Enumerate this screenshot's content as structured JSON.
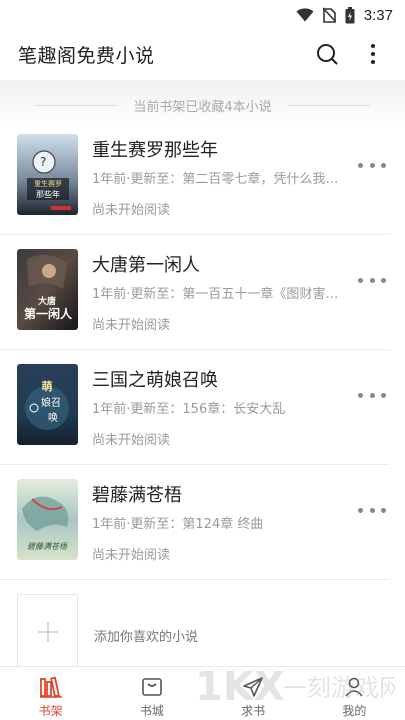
{
  "status_bar": {
    "time": "3:37",
    "icons": [
      "wifi-icon",
      "no-sim-icon",
      "battery-icon"
    ]
  },
  "app_bar": {
    "title": "笔趣阁免费小说",
    "actions": [
      "search-icon",
      "more-vertical-icon"
    ]
  },
  "shelf": {
    "summary": "当前书架已收藏4本小说",
    "books": [
      {
        "title": "重生赛罗那些年",
        "meta": "1年前·更新至：第二百零七章，凭什么我…",
        "progress": "尚未开始阅读",
        "cover_text": "重生赛罗那些年"
      },
      {
        "title": "大唐第一闲人",
        "meta": "1年前·更新至：第一百五十一章《图财害…",
        "progress": "尚未开始阅读",
        "cover_text": "大唐第一闲人"
      },
      {
        "title": "三国之萌娘召唤",
        "meta": "1年前·更新至：156章：长安大乱",
        "progress": "尚未开始阅读",
        "cover_text": "萌娘召唤"
      },
      {
        "title": "碧藤满苍梧",
        "meta": "1年前·更新至：第124章 终曲",
        "progress": "尚未开始阅读",
        "cover_text": "碧藤满苍梧"
      }
    ],
    "add_label": "添加你喜欢的小说"
  },
  "tabs": [
    {
      "label": "书架",
      "icon": "bookshelf-icon",
      "active": true
    },
    {
      "label": "书城",
      "icon": "bookstore-icon",
      "active": false
    },
    {
      "label": "求书",
      "icon": "paper-plane-icon",
      "active": false
    },
    {
      "label": "我的",
      "icon": "person-icon",
      "active": false
    }
  ],
  "colors": {
    "accent": "#e0452c",
    "text_primary": "#222222",
    "text_secondary": "#9a9a9a"
  },
  "watermark": "1KX 一刻游戏网"
}
